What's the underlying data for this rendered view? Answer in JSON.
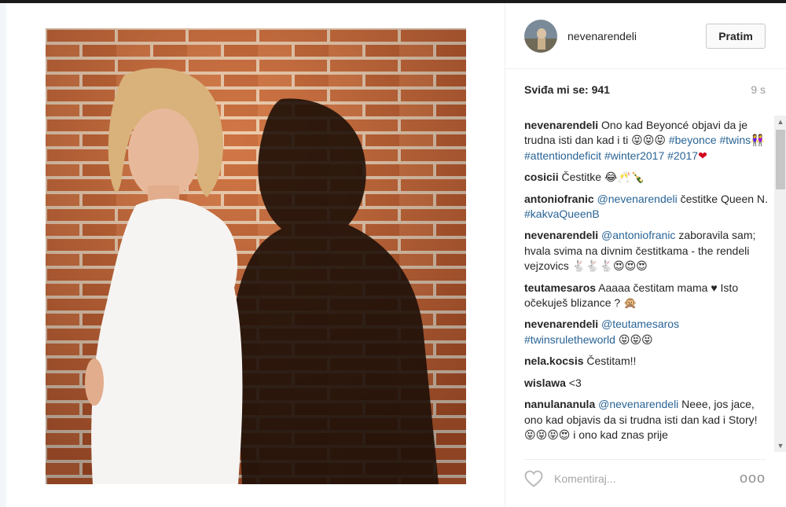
{
  "post": {
    "username": "nevenarendeli",
    "follow_label": "Pratim",
    "likes_label": "Sviđa mi se: 941",
    "time_ago": "9 s"
  },
  "comments": [
    {
      "author": "nevenarendeli",
      "parts": [
        {
          "t": "text",
          "v": " Ono kad Beyoncé objavi da je trudna isti dan kad i ti 😝😝😝 "
        },
        {
          "t": "tag",
          "v": "#beyonce"
        },
        {
          "t": "text",
          "v": " "
        },
        {
          "t": "tag",
          "v": "#twins👭"
        },
        {
          "t": "text",
          "v": " "
        },
        {
          "t": "tag",
          "v": "#attentiondeficit"
        },
        {
          "t": "text",
          "v": " "
        },
        {
          "t": "tag",
          "v": "#winter2017"
        },
        {
          "t": "text",
          "v": " "
        },
        {
          "t": "tag",
          "v": "#2017"
        },
        {
          "t": "heart",
          "v": "❤"
        }
      ]
    },
    {
      "author": "cosicii",
      "parts": [
        {
          "t": "text",
          "v": " Čestitke 😂🥂🍾"
        }
      ]
    },
    {
      "author": "antoniofranic",
      "parts": [
        {
          "t": "text",
          "v": " "
        },
        {
          "t": "tag",
          "v": "@nevenarendeli"
        },
        {
          "t": "text",
          "v": " čestitke Queen N. "
        },
        {
          "t": "tag",
          "v": "#kakvaQueenB"
        }
      ]
    },
    {
      "author": "nevenarendeli",
      "parts": [
        {
          "t": "text",
          "v": " "
        },
        {
          "t": "tag",
          "v": "@antoniofranic"
        },
        {
          "t": "text",
          "v": " zaboravila sam; hvala svima na divnim čestitkama - the rendeli vejzovics 🐇🐇🐇😍😍😍"
        }
      ]
    },
    {
      "author": "teutamesaros",
      "parts": [
        {
          "t": "text",
          "v": " Aaaaa čestitam mama ♥ Isto očekuješ blizance ? 🙊"
        }
      ]
    },
    {
      "author": "nevenarendeli",
      "parts": [
        {
          "t": "text",
          "v": " "
        },
        {
          "t": "tag",
          "v": "@teutamesaros"
        },
        {
          "t": "text",
          "v": " "
        },
        {
          "t": "tag",
          "v": "#twinsruletheworld"
        },
        {
          "t": "text",
          "v": " 😝😝😝"
        }
      ]
    },
    {
      "author": "nela.kocsis",
      "parts": [
        {
          "t": "text",
          "v": " Čestitam!!"
        }
      ]
    },
    {
      "author": "wislawa",
      "parts": [
        {
          "t": "text",
          "v": " <3"
        }
      ]
    },
    {
      "author": "nanulananula",
      "parts": [
        {
          "t": "text",
          "v": " "
        },
        {
          "t": "tag",
          "v": "@nevenarendeli"
        },
        {
          "t": "text",
          "v": " Neee, jos jace, ono kad objavis da si trudna isti dan kad i Story! 😝😝😝😍 i ono kad znas prije"
        }
      ]
    }
  ],
  "footer": {
    "comment_placeholder": "Komentiraj...",
    "more_label": "ooo"
  },
  "scrollbar": {
    "up_arrow": "▲",
    "down_arrow": "▼"
  },
  "colors": {
    "hashtag": "#2a6496",
    "heart_emoji": "#d0021b",
    "brick": "#b8542b"
  },
  "icons": {
    "like": "heart-outline-icon",
    "more": "ellipsis-icon"
  }
}
